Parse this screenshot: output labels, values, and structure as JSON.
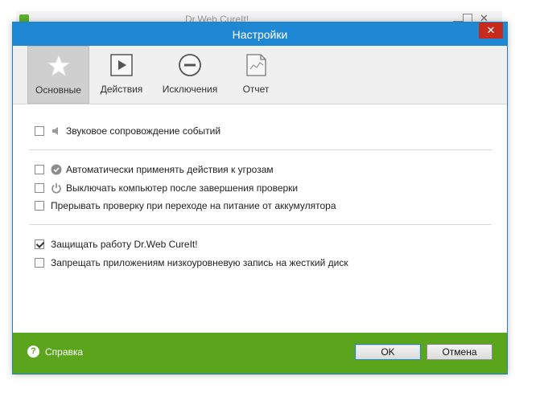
{
  "background_window": {
    "title": "Dr.Web CureIt!"
  },
  "dialog": {
    "title": "Настройки",
    "close_icon": "close-icon"
  },
  "tabs": [
    {
      "label": "Основные",
      "icon": "star-icon",
      "active": true
    },
    {
      "label": "Действия",
      "icon": "play-icon",
      "active": false
    },
    {
      "label": "Исключения",
      "icon": "minus-circle-icon",
      "active": false
    },
    {
      "label": "Отчет",
      "icon": "report-icon",
      "active": false
    }
  ],
  "options": {
    "sound": {
      "label": "Звуковое сопровождение событий",
      "checked": false,
      "icon": "speaker-icon"
    },
    "auto_apply": {
      "label": "Автоматически применять действия к угрозам",
      "checked": false,
      "icon": "check-circle-icon"
    },
    "shutdown": {
      "label": "Выключать компьютер после завершения проверки",
      "checked": false,
      "icon": "power-icon"
    },
    "battery": {
      "label": "Прерывать проверку при переходе на питание от аккумулятора",
      "checked": false
    },
    "protect": {
      "label": "Защищать работу Dr.Web CureIt!",
      "checked": true
    },
    "lowlevel": {
      "label": "Запрещать приложениям низкоуровневую запись на жесткий диск",
      "checked": false
    }
  },
  "footer": {
    "help_label": "Справка",
    "ok_label": "OK",
    "cancel_label": "Отмена",
    "color": "#5aa51c"
  },
  "colors": {
    "titlebar": "#1e88d5",
    "close": "#c42b1c"
  }
}
